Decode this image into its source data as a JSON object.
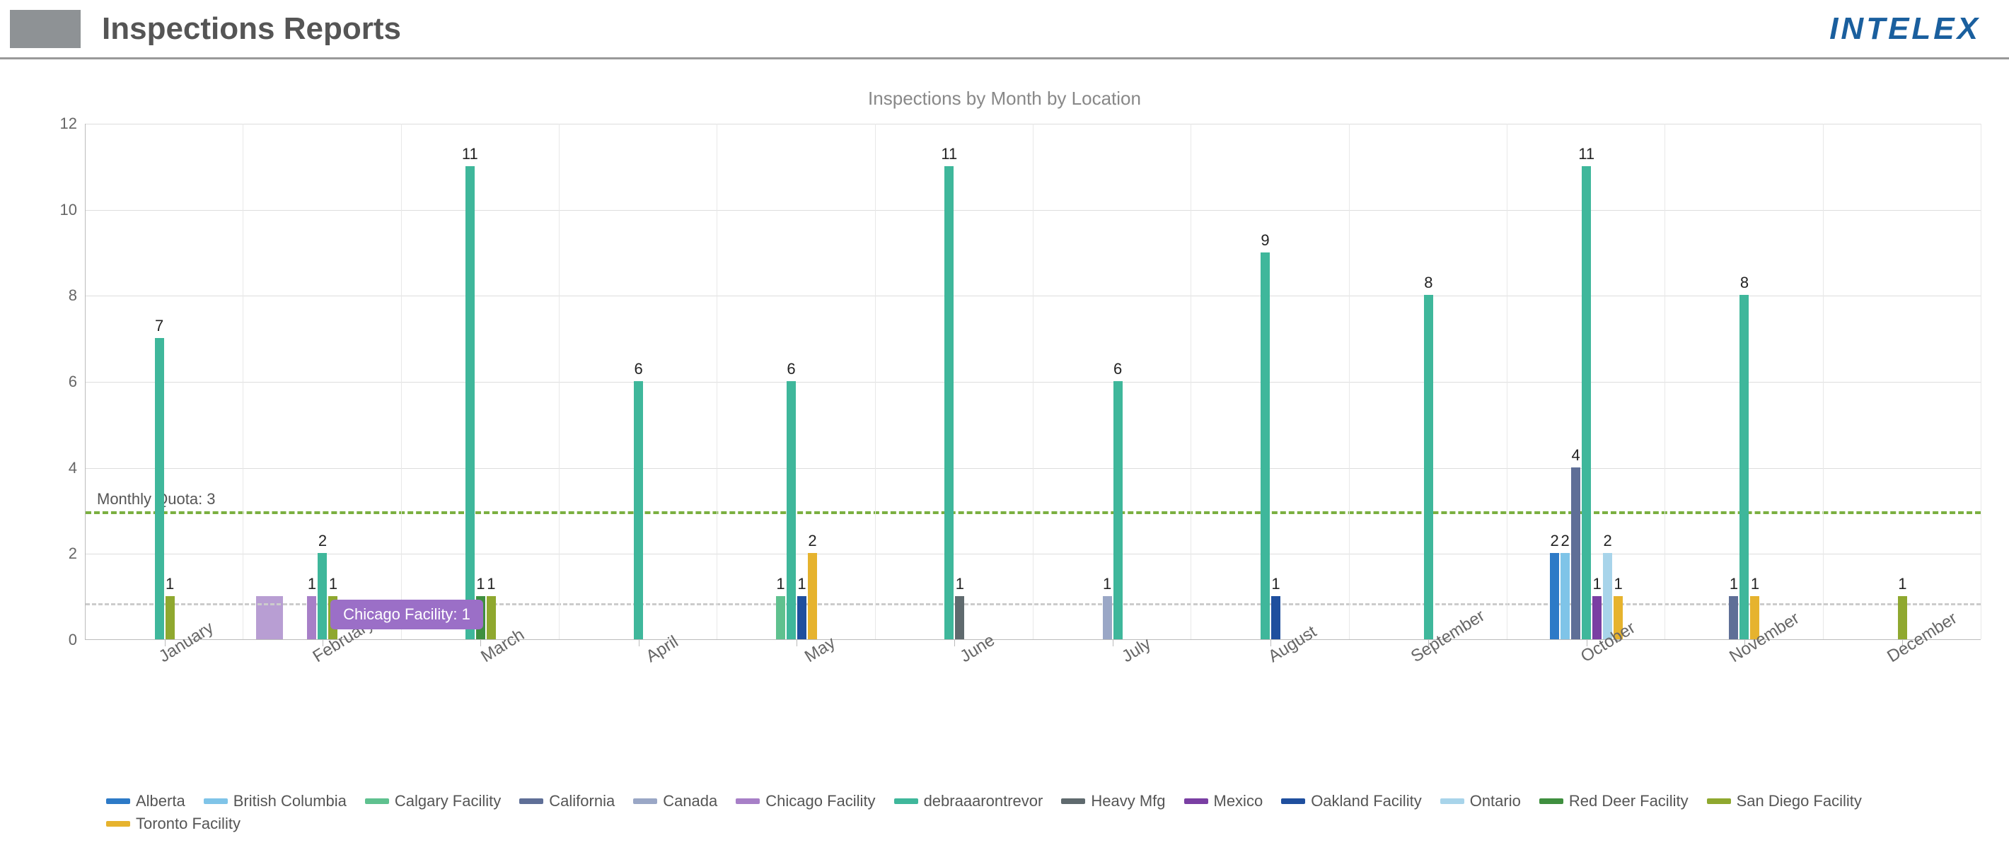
{
  "header": {
    "title": "Inspections Reports",
    "logo": "INTELEX"
  },
  "chart_title": "Inspections by Month by Location",
  "tooltip": {
    "text": "Chicago Facility:  1"
  },
  "quota": {
    "label": "Monthly Quota: 3",
    "value": 3
  },
  "chart_data": {
    "type": "bar",
    "title": "Inspections by Month by Location",
    "xlabel": "",
    "ylabel": "",
    "ylim": [
      0,
      12
    ],
    "y_ticks": [
      0,
      2,
      4,
      6,
      8,
      10,
      12
    ],
    "reference_lines": [
      {
        "label": "Monthly Quota: 3",
        "value": 3,
        "style": "dashed",
        "color": "#7bb041"
      }
    ],
    "categories": [
      "January",
      "February",
      "March",
      "April",
      "May",
      "June",
      "July",
      "August",
      "September",
      "October",
      "November",
      "December"
    ],
    "series": [
      {
        "name": "Alberta",
        "color": "#2d7ac7",
        "values": [
          null,
          null,
          null,
          null,
          null,
          null,
          null,
          null,
          null,
          2,
          null,
          null
        ]
      },
      {
        "name": "British Columbia",
        "color": "#7fc4e8",
        "values": [
          null,
          null,
          null,
          null,
          null,
          null,
          null,
          null,
          null,
          2,
          null,
          null
        ]
      },
      {
        "name": "Calgary Facility",
        "color": "#5fc18f",
        "values": [
          null,
          null,
          null,
          null,
          1,
          null,
          null,
          null,
          null,
          null,
          null,
          null
        ]
      },
      {
        "name": "California",
        "color": "#5f6f97",
        "values": [
          null,
          null,
          null,
          null,
          null,
          null,
          null,
          null,
          null,
          4,
          1,
          null
        ]
      },
      {
        "name": "Canada",
        "color": "#9aa7c6",
        "values": [
          null,
          null,
          null,
          null,
          null,
          null,
          1,
          null,
          null,
          null,
          null,
          null
        ]
      },
      {
        "name": "Chicago Facility",
        "color": "#a77fc7",
        "values": [
          null,
          1,
          null,
          null,
          null,
          null,
          null,
          null,
          null,
          null,
          null,
          null
        ]
      },
      {
        "name": "debraaarontrevor",
        "color": "#3fb79b",
        "values": [
          7,
          2,
          11,
          6,
          6,
          11,
          6,
          9,
          8,
          11,
          8,
          null
        ]
      },
      {
        "name": "Heavy Mfg",
        "color": "#5f6a6e",
        "values": [
          null,
          null,
          null,
          null,
          null,
          1,
          null,
          null,
          null,
          null,
          null,
          null
        ]
      },
      {
        "name": "Mexico",
        "color": "#7a3fa3",
        "values": [
          null,
          null,
          null,
          null,
          null,
          null,
          null,
          null,
          null,
          1,
          null,
          null
        ]
      },
      {
        "name": "Oakland Facility",
        "color": "#1f4f9e",
        "values": [
          null,
          null,
          null,
          null,
          1,
          null,
          null,
          1,
          null,
          null,
          null,
          null
        ]
      },
      {
        "name": "Ontario",
        "color": "#a8d4ea",
        "values": [
          null,
          null,
          null,
          null,
          null,
          null,
          null,
          null,
          null,
          2,
          null,
          null
        ]
      },
      {
        "name": "Red Deer Facility",
        "color": "#3f8f3f",
        "values": [
          null,
          null,
          1,
          null,
          null,
          null,
          null,
          null,
          null,
          null,
          null,
          null
        ]
      },
      {
        "name": "San Diego Facility",
        "color": "#8fa82f",
        "values": [
          1,
          1,
          1,
          null,
          null,
          null,
          null,
          null,
          null,
          null,
          null,
          1
        ]
      },
      {
        "name": "Toronto Facility",
        "color": "#e6b32e",
        "values": [
          null,
          null,
          null,
          null,
          2,
          null,
          null,
          null,
          null,
          1,
          1,
          null
        ]
      }
    ]
  }
}
